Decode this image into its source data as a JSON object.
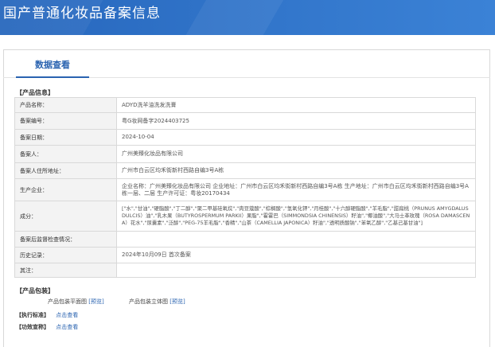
{
  "header": {
    "title": "国产普通化妆品备案信息"
  },
  "tabs": [
    {
      "label": "数据查看"
    }
  ],
  "product_info": {
    "section_title": "【产品信息】",
    "rows": [
      {
        "label": "产品名称：",
        "value": "ADYD洗羊油洗发洗膏"
      },
      {
        "label": "备案编号：",
        "value": "粤G妆网备字2024403725"
      },
      {
        "label": "备案日期：",
        "value": "2024-10-04"
      },
      {
        "label": "备案人：",
        "value": "广州美臻化妆品有限公司"
      },
      {
        "label": "备案人住所地址：",
        "value": "广州市白云区均禾街新村西路自编3号A栋"
      },
      {
        "label": "生产企业：",
        "value": "企业名称：广州美臻化妆品有限公司 企业地址：广州市白云区均禾街新村西路自编3号A栋 生产地址：广州市白云区均禾街新村西路自编3号A栋一层、二层 生产许可证：粤妆20170434"
      },
      {
        "label": "成分：",
        "value": "[\"水\",\"甘油\",\"硬脂酸\",\"丁二醇\",\"聚二甲基硅氧烷\",\"肉豆蔻酸\",\"棕榈酸\",\"氢氧化钾\",\"月桂酸\",\"十六醇硬脂酸\",\"羊毛脂\",\"甜扁桃（PRUNUS AMYGDALUS DULCIS）油\",\"乳木果（BUTYROSPERMUM PARKII）果脂\",\"霍霍巴（SIMMONDSIA CHINENSIS）籽油\",\"椰油酸\",\"大马士革玫瑰（ROSA DAMASCENA）花水\",\"尿囊素\",\"泛醇\",\"PEG-75羊毛脂\",\"香精\",\"山茶（CAMELLIA JAPONICA）籽油\",\"透明质酸钠\",\"苯氧乙醇\",\"乙基己基甘油\"]"
      },
      {
        "label": "备案后监督检查情况：",
        "value": ""
      },
      {
        "label": "历史记录：",
        "value": "2024年10月09日 首次备案"
      },
      {
        "label": "其注：",
        "value": ""
      }
    ]
  },
  "package_info": {
    "section_title": "【产品包装】",
    "items": [
      {
        "label": "产品包装平面图",
        "link": "[预览]"
      },
      {
        "label": "产品包装立体图",
        "link": "[预览]"
      }
    ]
  },
  "links": [
    {
      "section": "【执行标准】",
      "text": "点击查看"
    },
    {
      "section": "【功效宣称】",
      "text": "点击查看"
    }
  ]
}
